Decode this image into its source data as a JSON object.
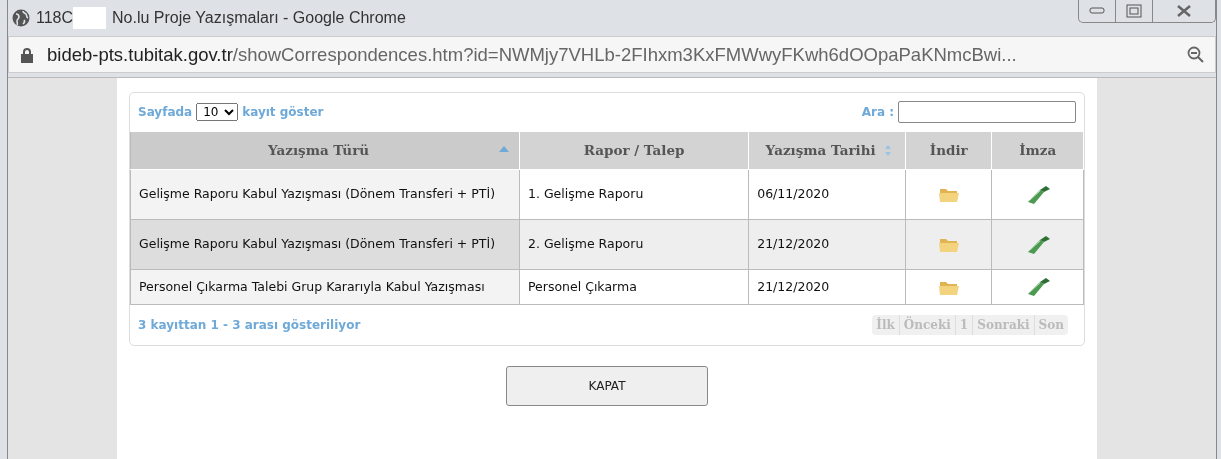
{
  "window": {
    "title_prefix": "118C",
    "title": "No.lu Proje Yazışmaları - Google Chrome"
  },
  "address_bar": {
    "host": "bideb-pts.tubitak.gov.tr",
    "path": "/showCorrespondences.htm?id=NWMjy7VHLb-2FIhxm3KxFMWwyFKwh6dOOpaPaKNmcBwi..."
  },
  "length_control": {
    "label_before": "Sayfada",
    "value": "10",
    "label_after": "kayıt göster"
  },
  "search": {
    "label": "Ara :"
  },
  "table": {
    "columns": [
      {
        "label": "Yazışma Türü",
        "sortable": true,
        "sorted": true
      },
      {
        "label": "Rapor / Talep",
        "sortable": false,
        "sorted": false
      },
      {
        "label": "Yazışma Tarihi",
        "sortable": true,
        "sorted": false
      },
      {
        "label": "İndir",
        "sortable": false,
        "sorted": false
      },
      {
        "label": "İmza",
        "sortable": false,
        "sorted": false
      }
    ],
    "rows": [
      {
        "type": "Gelişme Raporu Kabul Yazışması (Dönem Transferi + PTİ)",
        "report": "1. Gelişme Raporu",
        "date": "06/11/2020"
      },
      {
        "type": "Gelişme Raporu Kabul Yazışması (Dönem Transferi + PTİ)",
        "report": "2. Gelişme Raporu",
        "date": "21/12/2020"
      },
      {
        "type": "Personel Çıkarma Talebi Grup Kararıyla Kabul Yazışması",
        "report": "Personel Çıkarma",
        "date": "21/12/2020"
      }
    ]
  },
  "info": "3 kayıttan 1 - 3 arası gösteriliyor",
  "pagination": [
    {
      "label": "İlk",
      "disabled": true
    },
    {
      "label": "Önceki",
      "disabled": true
    },
    {
      "label": "1",
      "disabled": true
    },
    {
      "label": "Sonraki",
      "disabled": true
    },
    {
      "label": "Son",
      "disabled": true
    }
  ],
  "close_button": "KAPAT"
}
